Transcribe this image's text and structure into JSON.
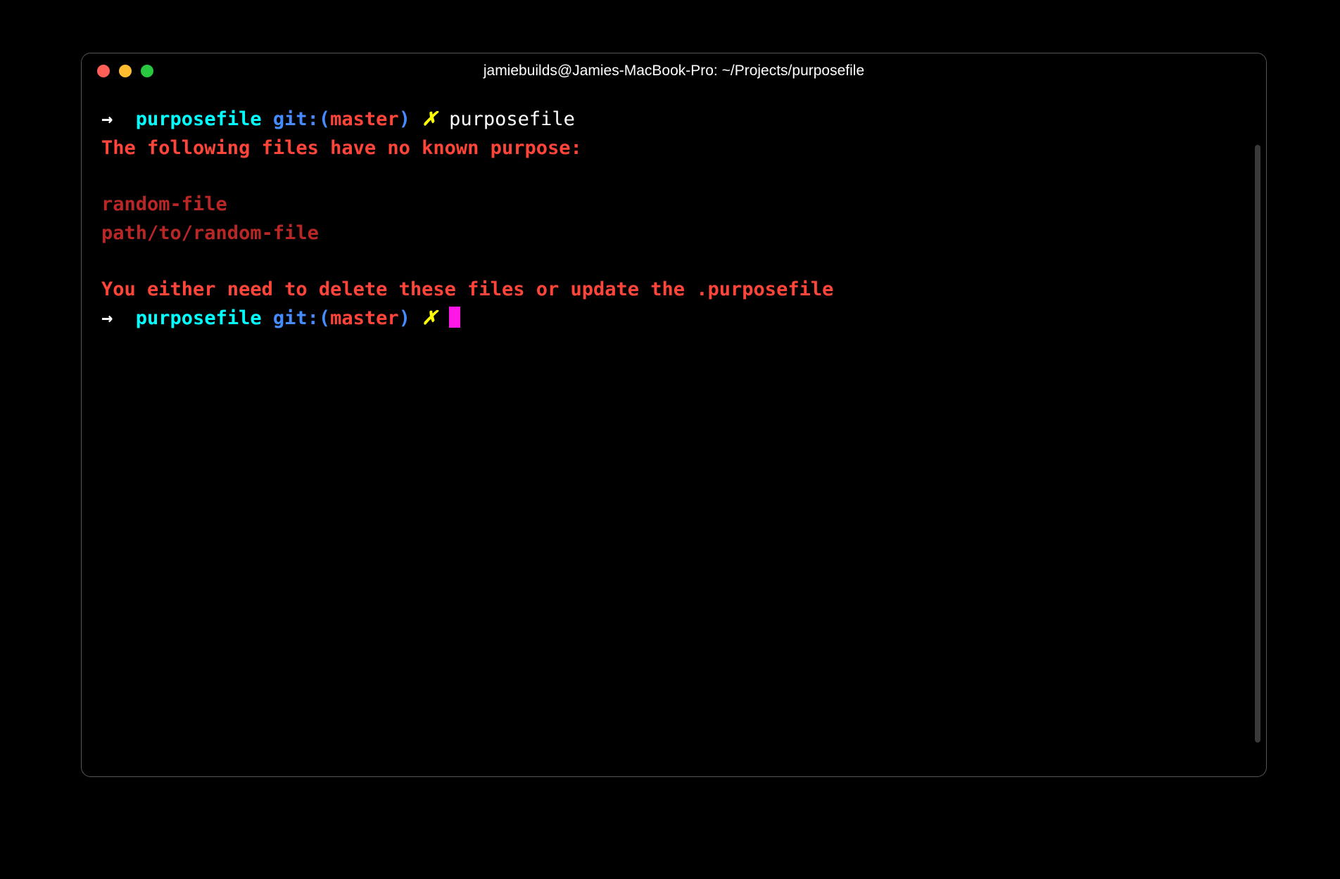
{
  "window": {
    "title": "jamiebuilds@Jamies-MacBook-Pro: ~/Projects/purposefile"
  },
  "prompt1": {
    "arrow": "→",
    "cwd": "purposefile",
    "git_label": "git:(",
    "branch": "master",
    "git_close": ")",
    "dirty": "✗",
    "command": "purposefile"
  },
  "output": {
    "heading": "The following files have no known purpose:",
    "files": [
      "random-file",
      "path/to/random-file"
    ],
    "message": "You either need to delete these files or update the .purposefile"
  },
  "prompt2": {
    "arrow": "→",
    "cwd": "purposefile",
    "git_label": "git:(",
    "branch": "master",
    "git_close": ")",
    "dirty": "✗"
  }
}
